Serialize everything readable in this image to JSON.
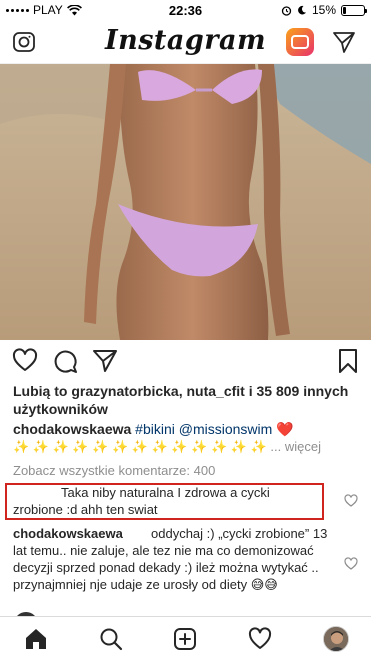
{
  "status_bar": {
    "carrier": "PLAY",
    "time": "22:36",
    "battery": "15%",
    "battery_level": 0.15
  },
  "header": {
    "brand": "Instagram"
  },
  "post": {
    "likes_text": "Lubią to grazynatorbicka, nuta_cfit i 35 809 innych użytkowników",
    "caption": {
      "username": "chodakowskaewa",
      "hashtag": "#bikini",
      "mention": "@missionswim",
      "heart": "❤️",
      "sparkles": "✨ ✨ ✨ ✨ ✨ ✨ ✨ ✨ ✨ ✨ ✨ ✨ ✨",
      "more_suffix": "...",
      "more_link": "więcej"
    },
    "view_all_comments": "Zobacz wszystkie komentarze: 400",
    "comments": [
      {
        "username": "",
        "text": "Taka niby naturalna I zdrowa a cycki zrobione :d ahh ten swiat"
      },
      {
        "username": "chodakowskaewa",
        "text": "oddychaj :) „cycki zrobione” 13 lat temu.. nie zaluje, ale tez nie ma co demonizować decyzji sprzed ponad dekady :) ileż można wytykać .. przynajmniej nje udaje ze urosły od diety 😅😅"
      }
    ]
  },
  "bottom_nav": {
    "items": [
      "home-icon",
      "search-icon",
      "add-post-icon",
      "activity-heart-icon",
      "profile-avatar"
    ]
  },
  "colors": {
    "highlight_border": "#d0251f",
    "link": "#003569",
    "muted": "#8e8e8e"
  }
}
